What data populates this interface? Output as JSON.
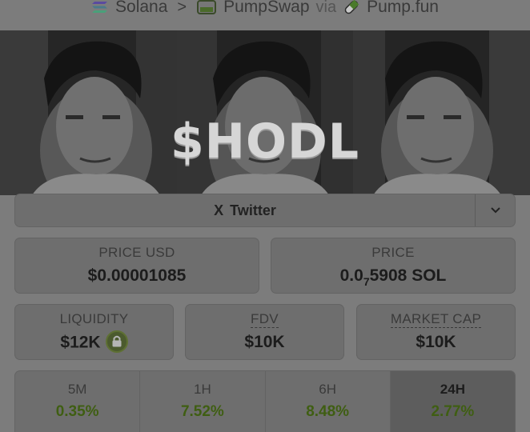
{
  "breadcrumb": {
    "chain": "Solana",
    "separator": ">",
    "dex": "PumpSwap",
    "via": "via",
    "launchpad": "Pump.fun"
  },
  "banner": {
    "ticker": "$HODL"
  },
  "social": {
    "twitter_label": "Twitter",
    "twitter_icon": "X"
  },
  "stats": {
    "price_usd": {
      "label": "PRICE USD",
      "value": "$0.00001085"
    },
    "price_native": {
      "label": "PRICE",
      "prefix": "0.0",
      "zeros": "7",
      "digits": "5908",
      "unit": "SOL"
    },
    "liquidity": {
      "label": "LIQUIDITY",
      "value": "$12K"
    },
    "fdv": {
      "label": "FDV",
      "value": "$10K"
    },
    "market_cap": {
      "label": "MARKET CAP",
      "value": "$10K"
    }
  },
  "timeframes": [
    {
      "label": "5M",
      "change": "0.35%"
    },
    {
      "label": "1H",
      "change": "7.52%"
    },
    {
      "label": "6H",
      "change": "8.48%"
    },
    {
      "label": "24H",
      "change": "2.77%"
    }
  ],
  "colors": {
    "positive": "#3f5e12",
    "lock_badge": "#4b5a2e"
  }
}
